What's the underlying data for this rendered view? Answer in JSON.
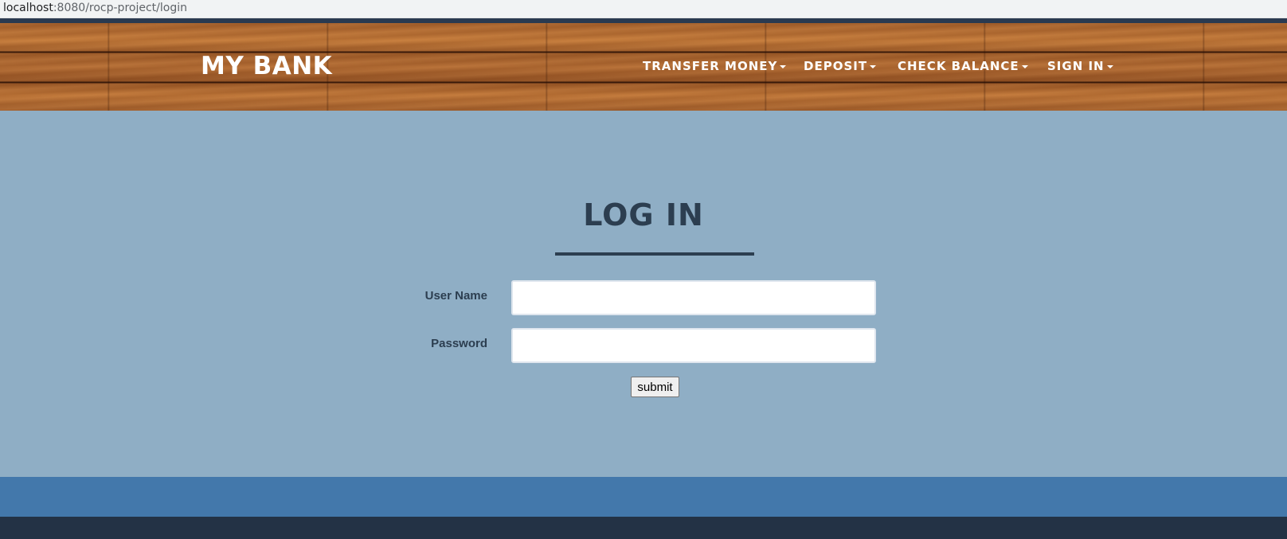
{
  "browser": {
    "url_host": "localhost",
    "url_path": ":8080/rocp-project/login"
  },
  "navbar": {
    "brand": "MY BANK",
    "items": [
      {
        "label": "TRANSFER MONEY",
        "icon": "caret-down-icon"
      },
      {
        "label": "DEPOSIT",
        "icon": "caret-down-icon"
      },
      {
        "label": "CHECK BALANCE",
        "icon": "caret-down-icon"
      },
      {
        "label": "SIGN IN",
        "icon": "caret-down-icon"
      }
    ]
  },
  "login": {
    "title": "LOG IN",
    "username_label": "User Name",
    "username_value": "",
    "password_label": "Password",
    "password_value": "",
    "submit_label": "submit"
  },
  "colors": {
    "main_background": "#8faec5",
    "heading": "#2c3e50",
    "footer_band": "#4378ab",
    "footer_bottom": "#233245"
  }
}
